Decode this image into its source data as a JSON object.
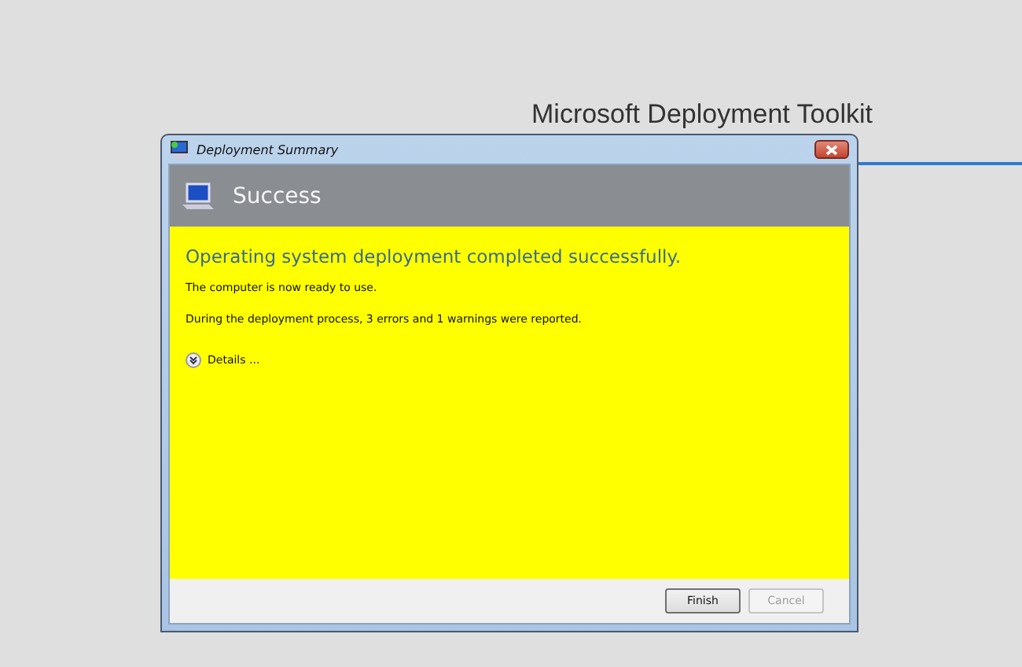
{
  "background": {
    "title": "Microsoft Deployment Toolkit"
  },
  "window": {
    "title": "Deployment Summary"
  },
  "header": {
    "title": "Success"
  },
  "content": {
    "heading": "Operating system deployment completed successfully.",
    "paragraphs": [
      "The computer is now ready to use.",
      "During the deployment process, 3 errors and 1 warnings were reported."
    ],
    "details": {
      "label": "Details ...",
      "expanded": false
    }
  },
  "buttons": [
    {
      "label": "Finish",
      "disabled": false
    },
    {
      "label": "Cancel",
      "disabled": true
    }
  ]
}
